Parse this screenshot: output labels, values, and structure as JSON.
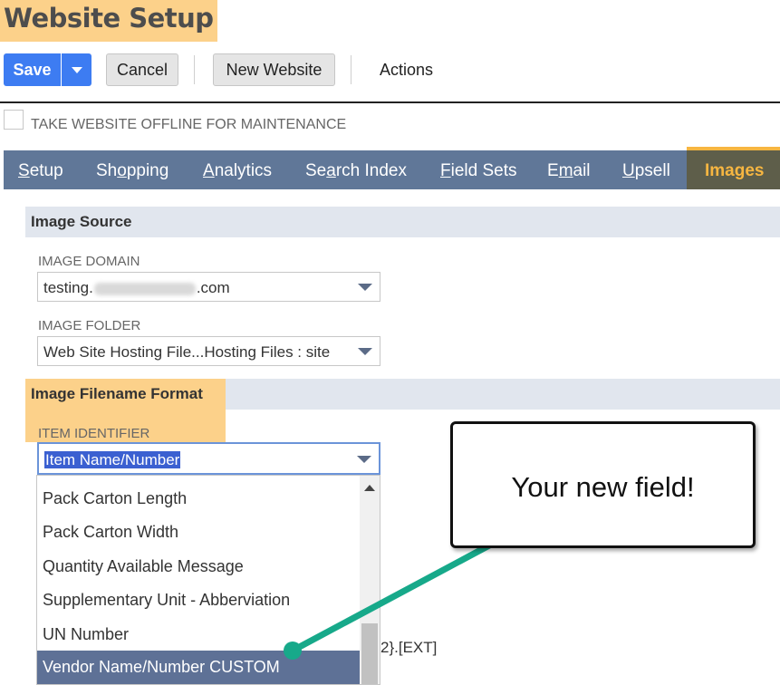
{
  "page": {
    "title": "Website Setup"
  },
  "toolbar": {
    "save_label": "Save",
    "cancel_label": "Cancel",
    "new_website_label": "New Website",
    "actions_label": "Actions"
  },
  "offline": {
    "label": "TAKE WEBSITE OFFLINE FOR MAINTENANCE",
    "checked": false
  },
  "tabs": [
    {
      "pre": "",
      "u": "S",
      "post": "etup"
    },
    {
      "pre": "Sh",
      "u": "o",
      "post": "pping"
    },
    {
      "pre": "",
      "u": "A",
      "post": "nalytics"
    },
    {
      "pre": "Se",
      "u": "a",
      "post": "rch Index"
    },
    {
      "pre": "",
      "u": "F",
      "post": "ield Sets"
    },
    {
      "pre": "E",
      "u": "m",
      "post": "ail"
    },
    {
      "pre": "",
      "u": "U",
      "post": "psell"
    }
  ],
  "active_tab": {
    "label": "Images"
  },
  "image_source": {
    "title": "Image Source",
    "domain_label": "IMAGE DOMAIN",
    "domain_prefix": "testing.",
    "domain_suffix": ".com",
    "folder_label": "IMAGE FOLDER",
    "folder_value": "Web Site Hosting File...Hosting Files : site"
  },
  "filename_format": {
    "title": "Image Filename Format",
    "identifier_label": "ITEM IDENTIFIER",
    "identifier_value": "Item Name/Number",
    "options": [
      "Pack Carton Length",
      "Pack Carton Width",
      "Quantity Available Message",
      "Supplementary Unit - Abberviation",
      "UN Number",
      "Vendor Name/Number CUSTOM"
    ],
    "selected_option": "Vendor Name/Number CUSTOM",
    "ext_text": "2}.[EXT]"
  },
  "callout": {
    "text": "Your new field!"
  },
  "colors": {
    "highlight": "#fcd18a",
    "primary_button": "#3d7cf2",
    "tabbar": "#607798",
    "active_tab_text": "#f7b641",
    "connector": "#17a98a"
  }
}
